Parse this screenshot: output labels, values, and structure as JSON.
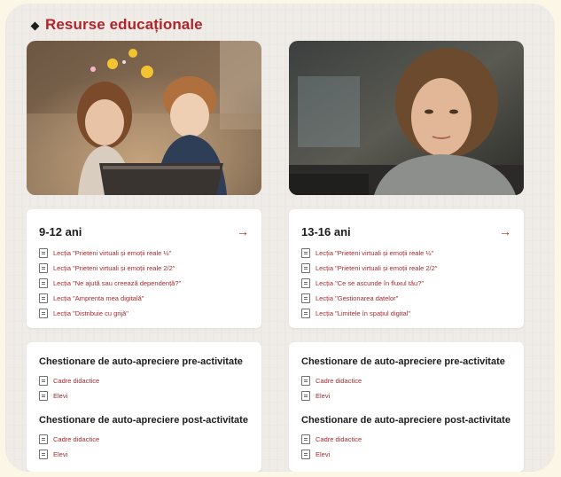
{
  "section_title": "Resurse educaționale",
  "photos": [
    {
      "icon": "children-with-tablet-photo"
    },
    {
      "icon": "teen-girl-photo"
    }
  ],
  "age_groups": [
    {
      "title": "9-12 ani",
      "lessons": [
        "Lecția \"Prieteni virtuali și emoții reale ½\"",
        "Lecția \"Prieteni virtuali și emoții reale 2/2\"",
        "Lecția \"Ne ajută sau creează dependență?\"",
        "Lecția \"Amprenta mea digitală\"",
        "Lecția \"Distribuie cu grijă\""
      ],
      "pre_title": "Chestionare de auto-apreciere pre-activitate",
      "pre_links": [
        "Cadre didactice",
        "Elevi"
      ],
      "post_title": "Chestionare de auto-apreciere post-activitate",
      "post_links": [
        "Cadre didactice",
        "Elevi"
      ]
    },
    {
      "title": "13-16 ani",
      "lessons": [
        "Lecția \"Prieteni virtuali și emoții reale ½\"",
        "Lecția \"Prieteni virtuali și emoții reale 2/2\"",
        "Lecția \"Ce se ascunde în fluxul tău?\"",
        "Lecția \"Gestionarea datelor\"",
        "Lecția \"Limitele în spațiul digital\""
      ],
      "pre_title": "Chestionare de auto-apreciere pre-activitate",
      "pre_links": [
        "Cadre didactice",
        "Elevi"
      ],
      "post_title": "Chestionare de auto-apreciere post-activitate",
      "post_links": [
        "Cadre didactice",
        "Elevi"
      ]
    }
  ],
  "colors": {
    "accent": "#b0252b",
    "background": "#efece7",
    "card": "#ffffff"
  }
}
